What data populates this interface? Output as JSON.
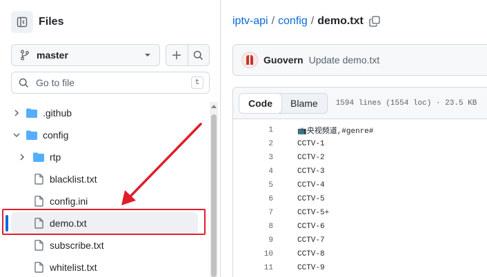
{
  "sidebar": {
    "title": "Files",
    "branch": "master",
    "search_placeholder": "Go to file",
    "search_shortcut": "t",
    "tree": [
      {
        "label": ".github",
        "type": "folder",
        "expanded": false,
        "depth": 0
      },
      {
        "label": "config",
        "type": "folder",
        "expanded": true,
        "depth": 0
      },
      {
        "label": "rtp",
        "type": "folder",
        "expanded": false,
        "depth": 1
      },
      {
        "label": "blacklist.txt",
        "type": "file",
        "depth": 1
      },
      {
        "label": "config.ini",
        "type": "file",
        "depth": 1
      },
      {
        "label": "demo.txt",
        "type": "file",
        "depth": 1,
        "active": true
      },
      {
        "label": "subscribe.txt",
        "type": "file",
        "depth": 1
      },
      {
        "label": "whitelist.txt",
        "type": "file",
        "depth": 1
      }
    ]
  },
  "breadcrumb": {
    "repo": "iptv-api",
    "folder": "config",
    "file": "demo.txt",
    "separator": "/"
  },
  "commit": {
    "author": "Guovern",
    "message": "Update demo.txt"
  },
  "file": {
    "tabs": [
      "Code",
      "Blame"
    ],
    "active_tab": "Code",
    "info": "1594 lines (1554 loc) · 23.5 KB",
    "lines": [
      {
        "n": "1",
        "text": "📺央视频道,#genre#"
      },
      {
        "n": "2",
        "text": "CCTV-1"
      },
      {
        "n": "3",
        "text": "CCTV-2"
      },
      {
        "n": "4",
        "text": "CCTV-3"
      },
      {
        "n": "5",
        "text": "CCTV-4"
      },
      {
        "n": "6",
        "text": "CCTV-5"
      },
      {
        "n": "7",
        "text": "CCTV-5+"
      },
      {
        "n": "8",
        "text": "CCTV-6"
      },
      {
        "n": "9",
        "text": "CCTV-7"
      },
      {
        "n": "10",
        "text": "CCTV-8"
      },
      {
        "n": "11",
        "text": "CCTV-9"
      }
    ]
  },
  "colors": {
    "accent": "#0969da",
    "folder": "#54aeff",
    "annotation": "#e11d2a"
  }
}
